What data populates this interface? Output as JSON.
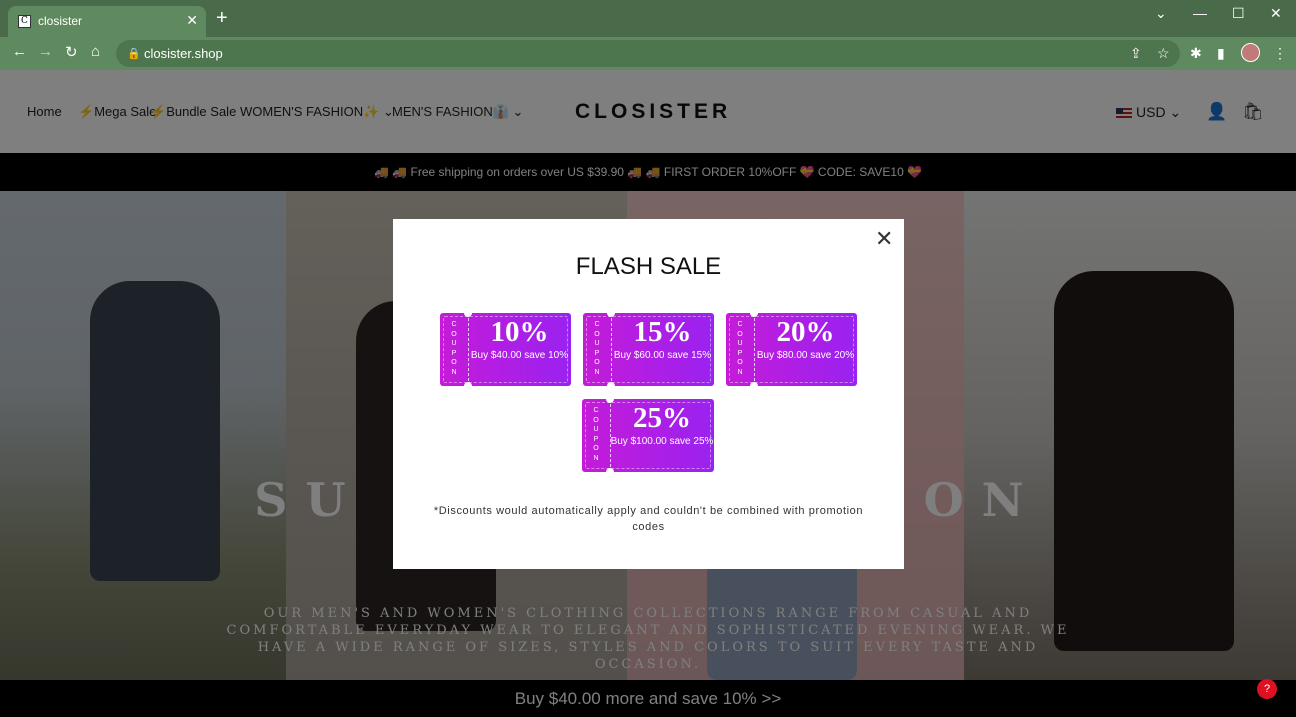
{
  "browser": {
    "tab_title": "closister",
    "tab_favicon": "C",
    "url": "closister.shop",
    "icons": [
      "back-icon",
      "forward-icon",
      "reload-icon",
      "home-icon",
      "lock-icon",
      "share-icon",
      "star-icon",
      "extensions-icon",
      "sidebar-icon",
      "profile-avatar",
      "menu-icon"
    ]
  },
  "header": {
    "nav": [
      "Home",
      "Mega Sale",
      "Bundle Sale",
      "WOMEN'S FASHION✨",
      "MEN'S FASHION👔"
    ],
    "logo": "CLOSISTER",
    "currency": "USD"
  },
  "announcement": "🚚 🚚 Free shipping on orders over US $39.90 🚚 🚚 FIRST ORDER 10%OFF 💝 CODE:  SAVE10 💝",
  "hero": {
    "headline_left": "SU",
    "headline_right": "ON",
    "subtext": "OUR MEN'S AND WOMEN'S CLOTHING COLLECTIONS RANGE FROM CASUAL AND COMFORTABLE EVERYDAY WEAR TO ELEGANT AND SOPHISTICATED EVENING WEAR. WE HAVE A WIDE RANGE OF SIZES, STYLES AND COLORS TO SUIT EVERY TASTE AND OCCASION."
  },
  "bottom_bar": "Buy $40.00 more and save 10%  >>",
  "modal": {
    "title": "FLASH SALE",
    "coupon_word": "COUPON",
    "coupons": [
      {
        "pct": "10%",
        "desc": "Buy $40.00 save 10%"
      },
      {
        "pct": "15%",
        "desc": "Buy $60.00 save 15%"
      },
      {
        "pct": "20%",
        "desc": "Buy $80.00 save 20%"
      },
      {
        "pct": "25%",
        "desc": "Buy $100.00 save 25%"
      }
    ],
    "note": "*Discounts would automatically apply and couldn't be combined with promotion codes"
  },
  "colors": {
    "coupon_start": "#c51bd8",
    "coupon_end": "#9a22f0",
    "chrome": "#5f8a5f"
  }
}
